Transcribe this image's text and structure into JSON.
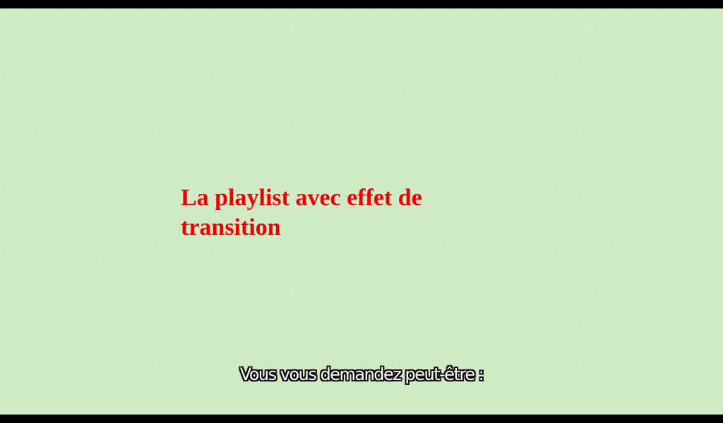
{
  "video": {
    "background_color": "#d1eac6",
    "title_color": "#ee0000"
  },
  "overlay": {
    "title": "La playlist avec effet de transition"
  },
  "captions": {
    "current": "Vous vous demandez peut-être :"
  }
}
